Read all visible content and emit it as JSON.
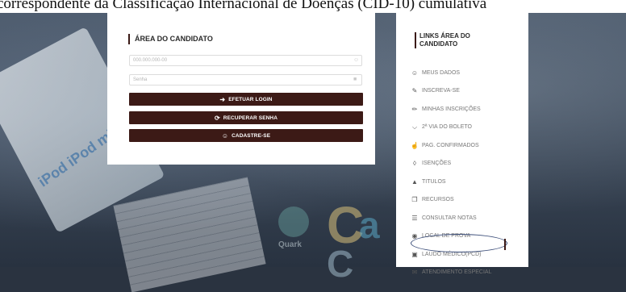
{
  "top_caption": "correspondente da Classificação Internacional de Doenças (CID-10) cumulativa",
  "background": {
    "ipod_text": "iPod  iPod mi",
    "logo_quark": "Quark",
    "logo_c": "C",
    "logo_a": "a"
  },
  "login": {
    "title": "ÁREA DO CANDIDATO",
    "cpf_placeholder": "000.000.000-00",
    "password_placeholder": "Senha",
    "login_button": "EFETUAR LOGIN",
    "recover_button": "RECUPERAR SENHA",
    "register_button": "CADASTRE-SE"
  },
  "sidebar": {
    "title": "LINKS ÁREA DO CANDIDATO",
    "items": [
      {
        "label": "MEUS DADOS",
        "icon": "user-icon"
      },
      {
        "label": "INSCREVA-SE",
        "icon": "pencil-icon"
      },
      {
        "label": "MINHAS INSCRIÇÕES",
        "icon": "edit-icon"
      },
      {
        "label": "2ª VIA DO BOLETO",
        "icon": "cart-icon"
      },
      {
        "label": "PAG. CONFIRMADOS",
        "icon": "thumbs-up-icon"
      },
      {
        "label": "ISENÇÕES",
        "icon": "tag-icon"
      },
      {
        "label": "TITULOS",
        "icon": "graduation-cap-icon"
      },
      {
        "label": "RECURSOS",
        "icon": "copy-icon"
      },
      {
        "label": "CONSULTAR NOTAS",
        "icon": "list-icon"
      },
      {
        "label": "LOCAL DE PROVA",
        "icon": "map-pin-icon"
      },
      {
        "label": "LAUDO MÉDICO(PCD)",
        "icon": "medical-kit-icon"
      },
      {
        "label": "ATENDIMENTO ESPECIAL",
        "icon": "chat-icon"
      }
    ]
  },
  "colors": {
    "brand": "#3c1a16",
    "highlight_ring": "#3d4f7a"
  }
}
